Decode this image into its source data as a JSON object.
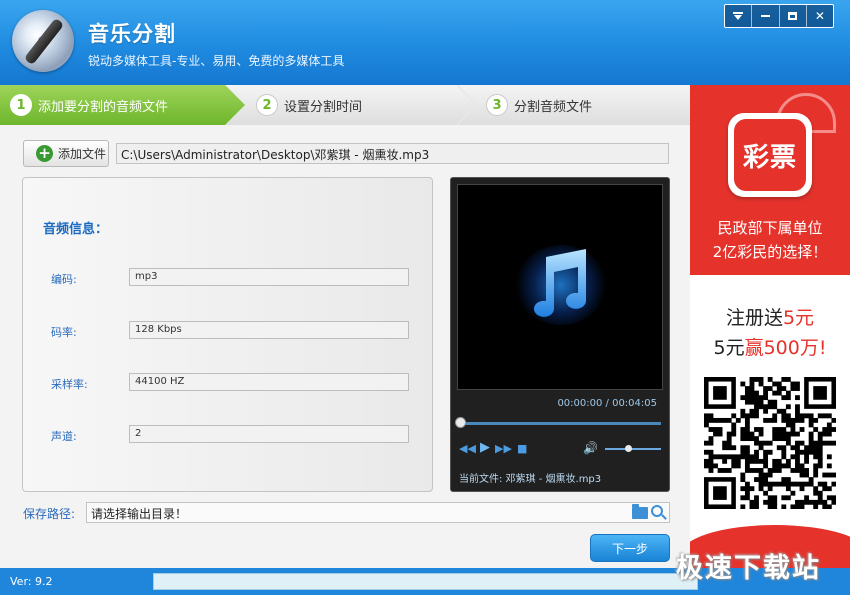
{
  "app": {
    "title": "音乐分割",
    "subtitle": "锐动多媒体工具-专业、易用、免费的多媒体工具"
  },
  "window_controls": [
    "menu-icon",
    "minimize-icon",
    "maximize-icon",
    "close-icon"
  ],
  "steps": [
    {
      "num": "1",
      "label": "添加要分割的音频文件",
      "active": true
    },
    {
      "num": "2",
      "label": "设置分割时间",
      "active": false
    },
    {
      "num": "3",
      "label": "分割音频文件",
      "active": false
    }
  ],
  "toolbar": {
    "add_file_label": "添加文件",
    "file_path": "C:\\Users\\Administrator\\Desktop\\邓紫琪 - 烟熏妆.mp3"
  },
  "audio_info": {
    "title": "音频信息：",
    "rows": [
      {
        "label": "编码:",
        "value": "mp3"
      },
      {
        "label": "码率:",
        "value": "128 Kbps"
      },
      {
        "label": "采样率:",
        "value": "44100 HZ"
      },
      {
        "label": "声道:",
        "value": "2"
      }
    ]
  },
  "player": {
    "time": "00:00:00 / 00:04:05",
    "seek_progress": 0.0,
    "volume_level": 0.35,
    "now_playing": "当前文件: 邓紫琪 - 烟熏妆.mp3"
  },
  "save": {
    "label": "保存路径:",
    "placeholder_value": "请选择输出目录！"
  },
  "next_label": "下一步",
  "ad": {
    "logo_text": "彩票",
    "line1": "民政部下属单位",
    "line2": "2亿彩民的选择！",
    "promo1_a": "注册送",
    "promo1_b": "5元",
    "promo2_a": "5元",
    "promo2_b": "赢500万!"
  },
  "status": {
    "version": "Ver: 9.2",
    "progress": 0.0
  },
  "watermark": "极速下载站",
  "colors": {
    "header_blue": "#1f8be0",
    "step_green": "#6db62c",
    "label_blue": "#2a6bbd",
    "ad_red": "#e5332c",
    "status_blue": "#1f86db"
  }
}
